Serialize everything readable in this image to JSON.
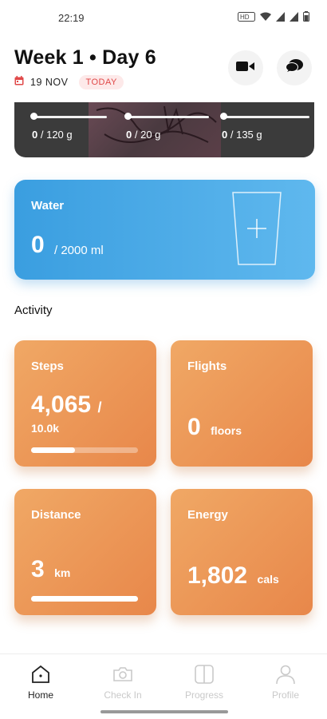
{
  "status_bar": {
    "time": "22:19"
  },
  "header": {
    "title": "Week 1 • Day 6",
    "date": "19 NOV",
    "today_badge": "TODAY"
  },
  "macros": [
    {
      "value": "0",
      "goal": "/ 120 g",
      "progress": 0
    },
    {
      "value": "0",
      "goal": "/ 20 g",
      "progress": 0
    },
    {
      "value": "0",
      "goal": "/ 135 g",
      "progress": 0
    }
  ],
  "water": {
    "label": "Water",
    "value": "0",
    "goal": "/ 2000 ml"
  },
  "activity": {
    "title": "Activity",
    "steps": {
      "label": "Steps",
      "value": "4,065",
      "slash": "/",
      "goal": "10.0k",
      "progress": 0.41
    },
    "flights": {
      "label": "Flights",
      "value": "0",
      "unit": "floors"
    },
    "distance": {
      "label": "Distance",
      "value": "3",
      "unit": "km",
      "progress": 1.0
    },
    "energy": {
      "label": "Energy",
      "value": "1,802",
      "unit": "cals"
    }
  },
  "nav": {
    "items": [
      {
        "label": "Home",
        "icon": "home-icon",
        "active": true
      },
      {
        "label": "Check In",
        "icon": "camera-icon",
        "active": false
      },
      {
        "label": "Progress",
        "icon": "progress-icon",
        "active": false
      },
      {
        "label": "Profile",
        "icon": "profile-icon",
        "active": false
      }
    ]
  },
  "colors": {
    "water_card": "#3a9ee0",
    "activity_card": "#ec9555",
    "today_badge": "#e04848"
  }
}
